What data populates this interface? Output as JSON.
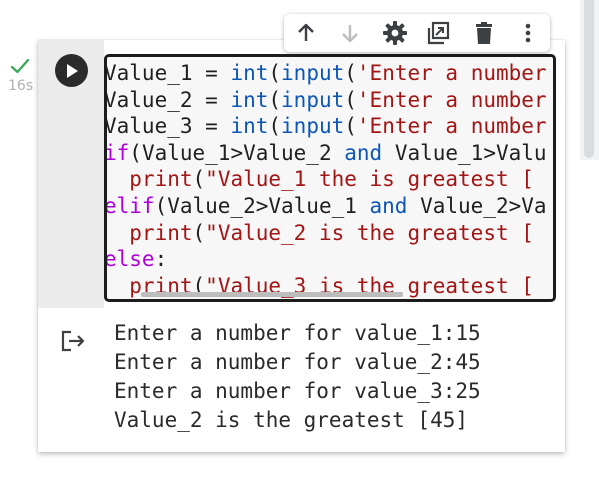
{
  "cell": {
    "status": "success",
    "exec_time": "16s",
    "code_lines": [
      [
        {
          "t": "Value_1 = ",
          "c": "id"
        },
        {
          "t": "int",
          "c": "fn"
        },
        {
          "t": "(",
          "c": "id"
        },
        {
          "t": "input",
          "c": "fn"
        },
        {
          "t": "(",
          "c": "id"
        },
        {
          "t": "'Enter a number",
          "c": "st"
        }
      ],
      [
        {
          "t": "Value_2 = ",
          "c": "id"
        },
        {
          "t": "int",
          "c": "fn"
        },
        {
          "t": "(",
          "c": "id"
        },
        {
          "t": "input",
          "c": "fn"
        },
        {
          "t": "(",
          "c": "id"
        },
        {
          "t": "'Enter a number",
          "c": "st"
        }
      ],
      [
        {
          "t": "Value_3 = ",
          "c": "id"
        },
        {
          "t": "int",
          "c": "fn"
        },
        {
          "t": "(",
          "c": "id"
        },
        {
          "t": "input",
          "c": "fn"
        },
        {
          "t": "(",
          "c": "id"
        },
        {
          "t": "'Enter a number",
          "c": "st"
        }
      ],
      [
        {
          "t": "if",
          "c": "kw"
        },
        {
          "t": "(Value_1>Value_2 ",
          "c": "id"
        },
        {
          "t": "and",
          "c": "fn"
        },
        {
          "t": " Value_1>Valu",
          "c": "id"
        }
      ],
      [
        {
          "t": "  print",
          "c": "st"
        },
        {
          "t": "(",
          "c": "id"
        },
        {
          "t": "\"Value_1 the is greatest [",
          "c": "st"
        }
      ],
      [
        {
          "t": "elif",
          "c": "kw"
        },
        {
          "t": "(Value_2>Value_1 ",
          "c": "id"
        },
        {
          "t": "and",
          "c": "fn"
        },
        {
          "t": " Value_2>Va",
          "c": "id"
        }
      ],
      [
        {
          "t": "  print",
          "c": "st"
        },
        {
          "t": "(",
          "c": "id"
        },
        {
          "t": "\"Value_2 is the greatest [",
          "c": "st"
        }
      ],
      [
        {
          "t": "else",
          "c": "kw"
        },
        {
          "t": ":",
          "c": "id"
        }
      ],
      [
        {
          "t": "  print",
          "c": "st"
        },
        {
          "t": "(",
          "c": "id"
        },
        {
          "t": "\"Value_3 is the greatest [",
          "c": "st"
        }
      ]
    ],
    "output_lines": [
      "Enter a number for value_1:15",
      "Enter a number for value_2:45",
      "Enter a number for value_3:25",
      "Value_2 is the greatest [45]"
    ]
  },
  "toolbar": {
    "items": [
      "move-up-icon",
      "move-down-icon",
      "settings-icon",
      "mirror-cell-icon",
      "delete-icon",
      "more-options-icon"
    ]
  },
  "colors": {
    "keyword": "#af00db",
    "function": "#0b56b8",
    "string": "#a31515",
    "success": "#34a853"
  }
}
